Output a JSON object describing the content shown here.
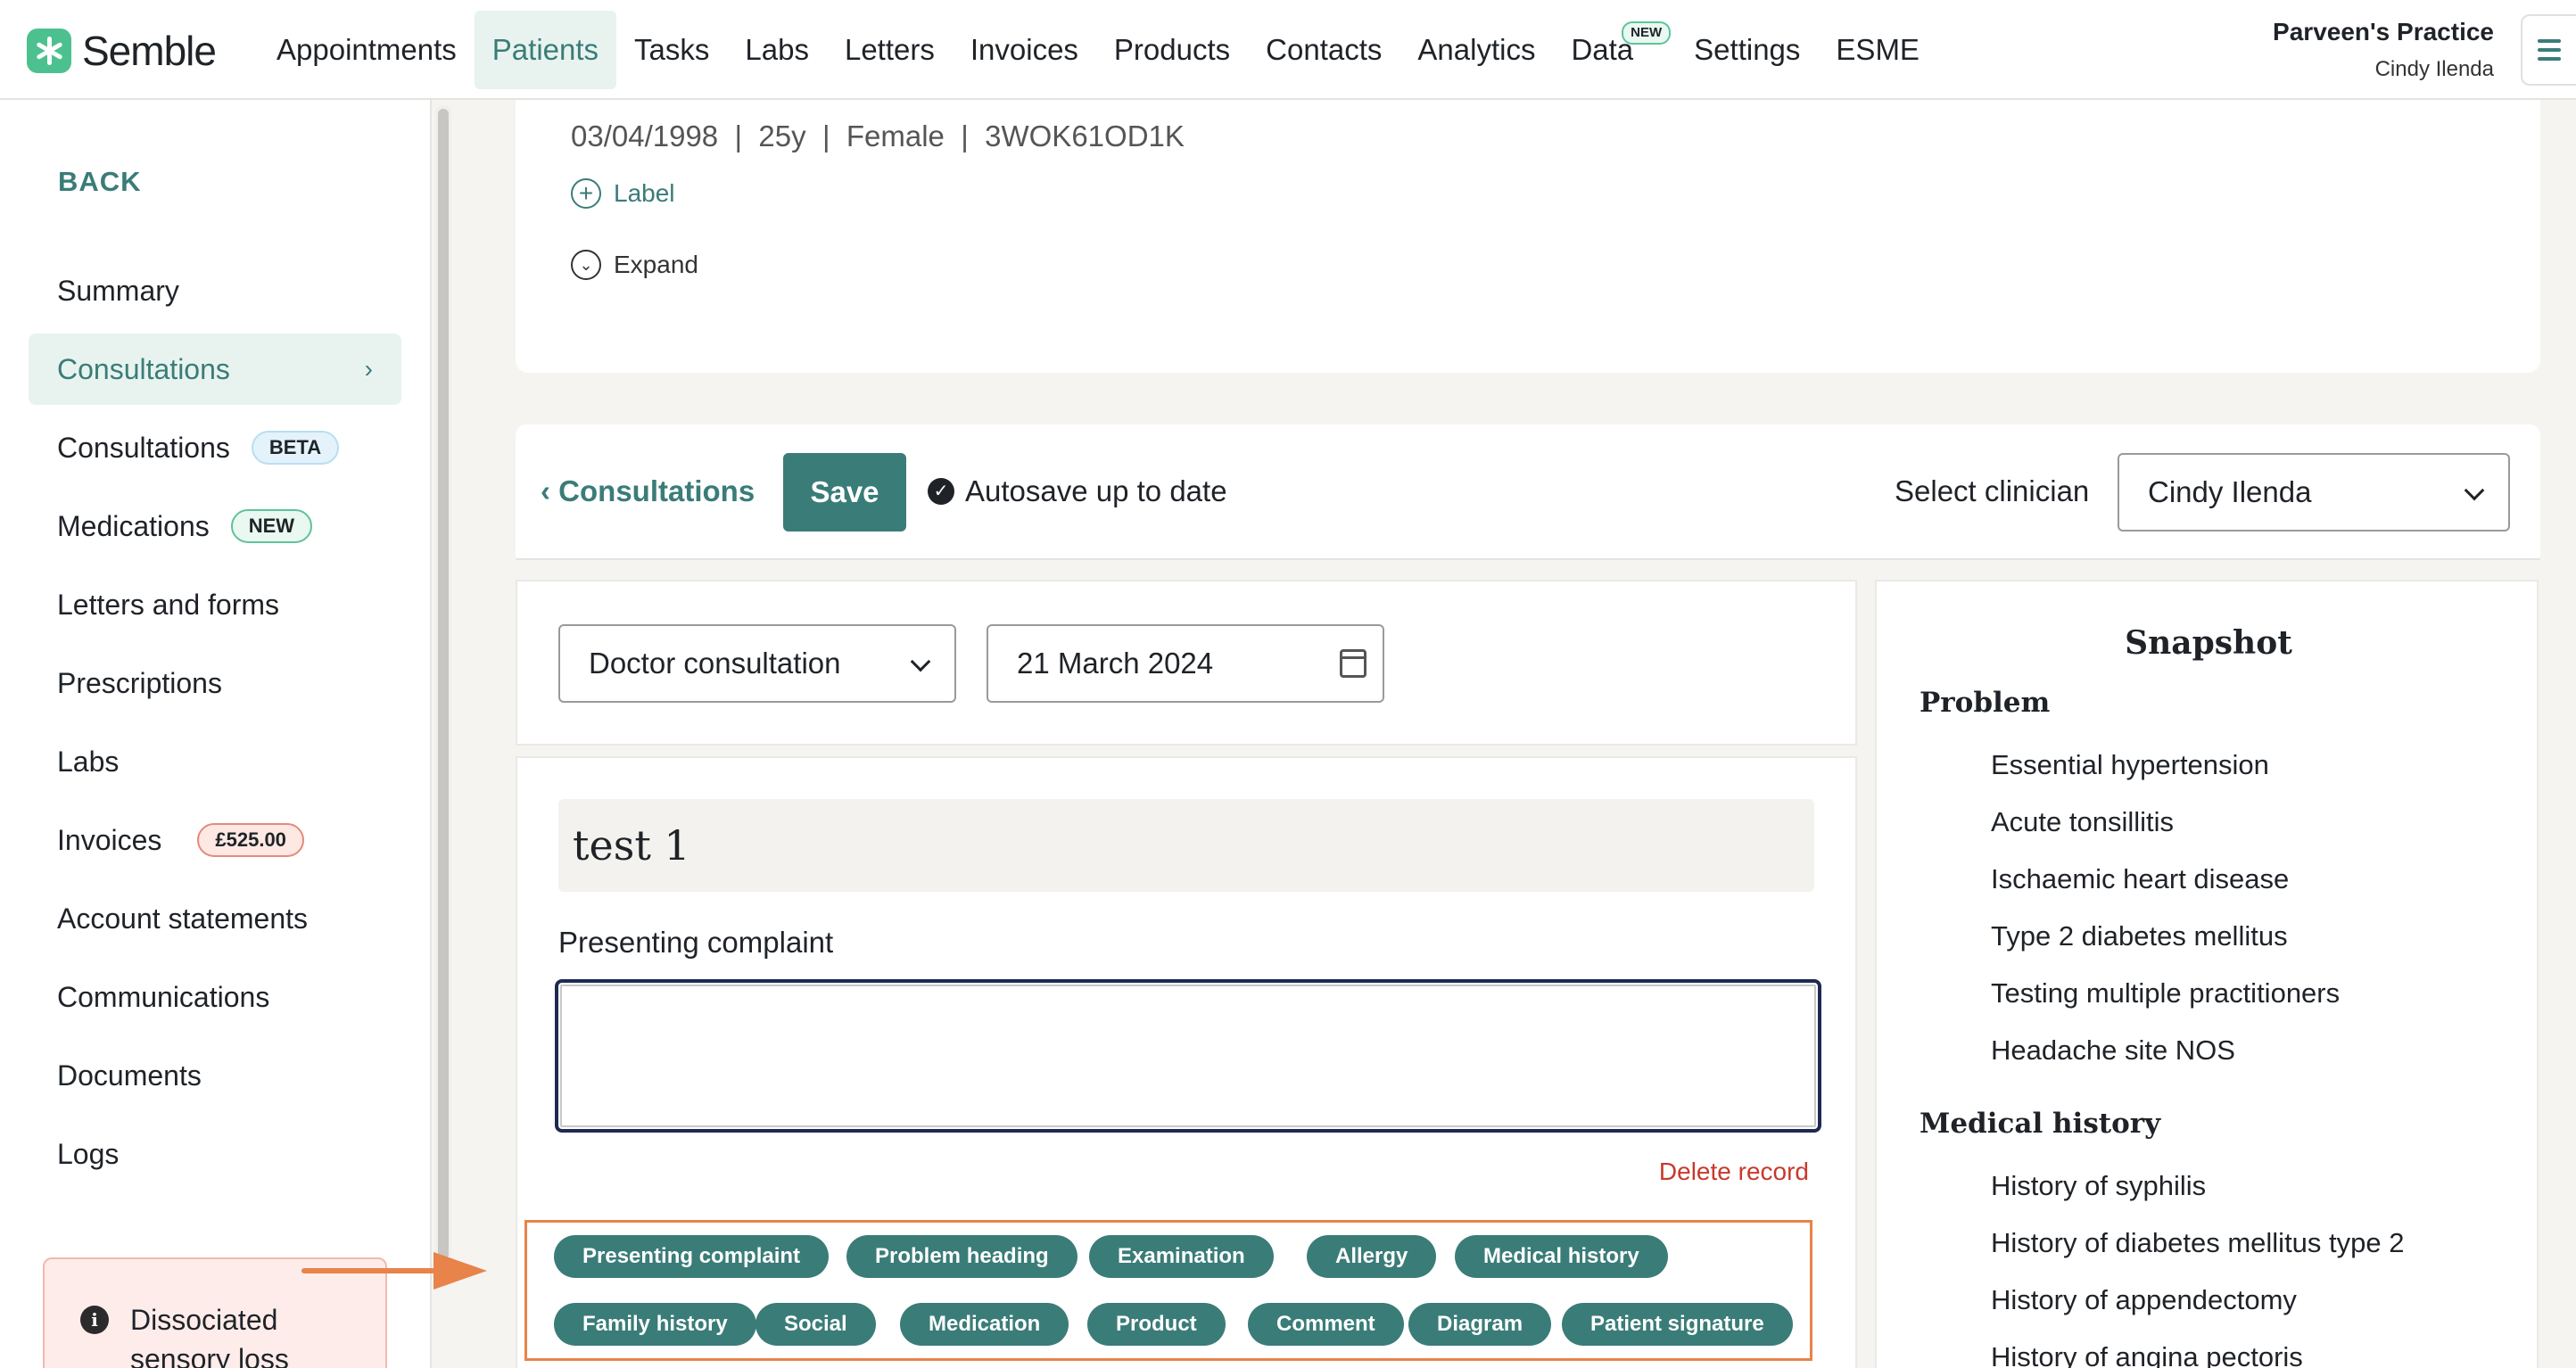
{
  "nav": {
    "brand": "Semble",
    "items": [
      "Appointments",
      "Patients",
      "Tasks",
      "Labs",
      "Letters",
      "Invoices",
      "Products",
      "Contacts",
      "Analytics",
      "Data",
      "Settings",
      "ESME"
    ],
    "active_item": "Patients",
    "data_badge": "NEW",
    "practice_name": "Parveen's Practice",
    "user_name": "Cindy Ilenda"
  },
  "sidebar": {
    "back": "BACK",
    "items": [
      {
        "label": "Summary"
      },
      {
        "label": "Consultations",
        "chevron": "›"
      },
      {
        "label": "Consultations",
        "badge": "BETA"
      },
      {
        "label": "Medications",
        "badge": "NEW"
      },
      {
        "label": "Letters and forms"
      },
      {
        "label": "Prescriptions"
      },
      {
        "label": "Labs"
      },
      {
        "label": "Invoices",
        "badge": "£525.00"
      },
      {
        "label": "Account statements"
      },
      {
        "label": "Communications"
      },
      {
        "label": "Documents"
      },
      {
        "label": "Logs"
      }
    ],
    "alert": {
      "icon": "i",
      "text_line1": "Dissociated",
      "text_line2": "sensory loss"
    }
  },
  "patient": {
    "info": "03/04/1998  |  25y  |  Female  |  3WOK61OD1K",
    "label_link": "Label",
    "expand_link": "Expand"
  },
  "toolbar": {
    "back_label": "Consultations",
    "save_label": "Save",
    "autosave_label": "Autosave up to date",
    "clinician_label": "Select clinician",
    "clinician_value": "Cindy Ilenda"
  },
  "form": {
    "consultation_type": "Doctor consultation",
    "date": "21 March 2024",
    "title": "test 1",
    "presenting_complaint_label": "Presenting complaint",
    "presenting_complaint_value": "",
    "delete_label": "Delete record",
    "chips_row1": [
      "Presenting complaint",
      "Problem heading",
      "Examination",
      "Allergy",
      "Medical history"
    ],
    "chips_row2": [
      "Family history",
      "Social",
      "Medication",
      "Product",
      "Comment",
      "Diagram",
      "Patient signature"
    ]
  },
  "snapshot": {
    "title": "Snapshot",
    "problem_heading": "Problem",
    "problems": [
      "Essential hypertension",
      "Acute tonsillitis",
      "Ischaemic heart disease",
      "Type 2 diabetes mellitus",
      "Testing multiple practitioners",
      "Headache site NOS"
    ],
    "history_heading": "Medical history",
    "history": [
      "History of syphilis",
      "History of diabetes mellitus type 2",
      "History of appendectomy",
      "History of angina pectoris"
    ]
  },
  "colors": {
    "accent": "#3a7c78",
    "accent_light": "#e8f3ef",
    "danger": "#c8392b",
    "annotation": "#e8834a"
  },
  "icons": [
    "semble-logo-icon",
    "menu-icon",
    "chevron-right-icon",
    "info-icon",
    "plus-circle-icon",
    "chevron-down-circle-icon",
    "chevron-left-icon",
    "check-circle-icon",
    "chevron-down-icon",
    "calendar-icon",
    "arrow-annotation-icon"
  ]
}
